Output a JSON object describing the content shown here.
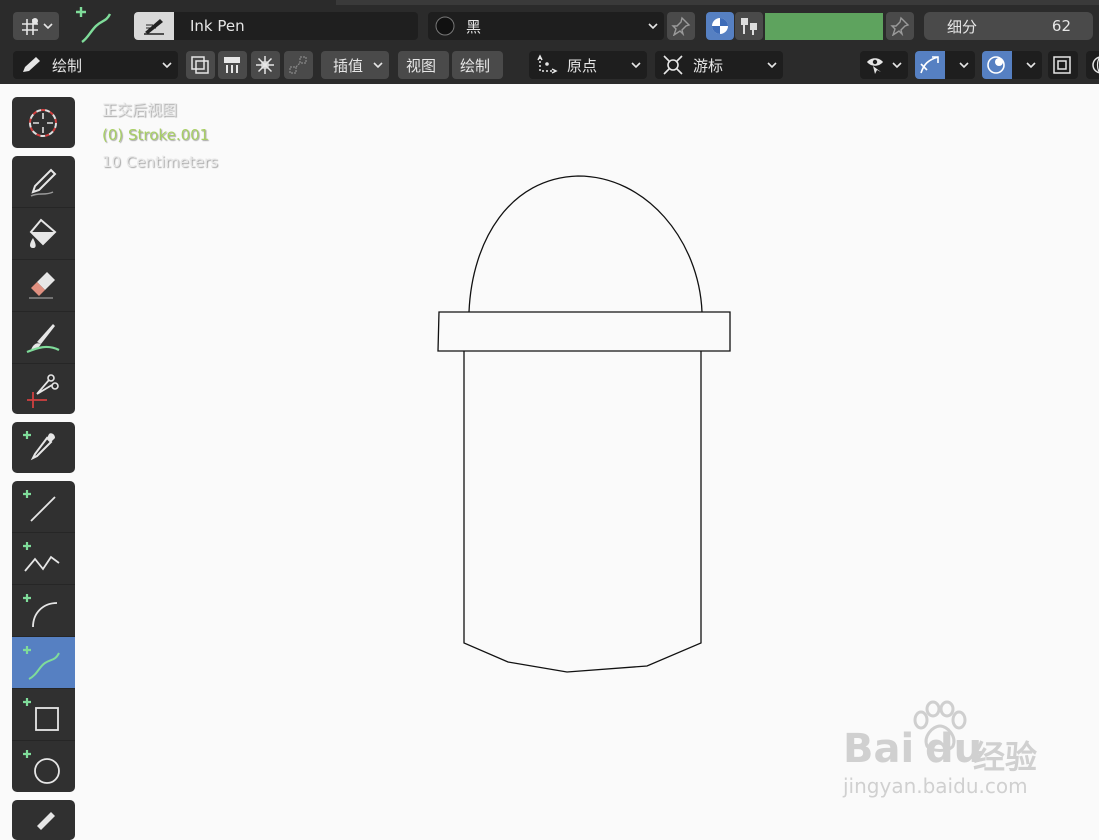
{
  "header": {
    "brush_name": "Ink Pen",
    "material_name": "黑",
    "subdivision_label": "细分",
    "subdivision_value": "62",
    "color_swatch": "#5ea35e"
  },
  "toolbar": {
    "mode_label": "绘制",
    "interpolate_label": "插值",
    "view_label": "视图",
    "draw_label": "绘制",
    "origin_label": "原点",
    "cursor_label": "游标"
  },
  "viewport": {
    "view_name": "正交后视图",
    "object_name": "(0) Stroke.001",
    "scale_label": "10 Centimeters",
    "object_color": "#a8cf64"
  },
  "tools": [
    {
      "name": "cursor"
    },
    {
      "name": "draw"
    },
    {
      "name": "fill"
    },
    {
      "name": "erase"
    },
    {
      "name": "tint"
    },
    {
      "name": "cutter"
    },
    {
      "name": "eyedropper"
    },
    {
      "name": "line"
    },
    {
      "name": "polyline"
    },
    {
      "name": "arc"
    },
    {
      "name": "curve",
      "active": true
    },
    {
      "name": "box"
    },
    {
      "name": "circle"
    },
    {
      "name": "annotate"
    }
  ],
  "watermark": {
    "brand": "Bai",
    "brand2": "du",
    "brand_cn": "经验",
    "url": "jingyan.baidu.com"
  },
  "colors": {
    "panel": "#2b2b2b",
    "widget": "#4a4a4a",
    "accent": "#5680c2",
    "plus": "#7fdc9a"
  }
}
